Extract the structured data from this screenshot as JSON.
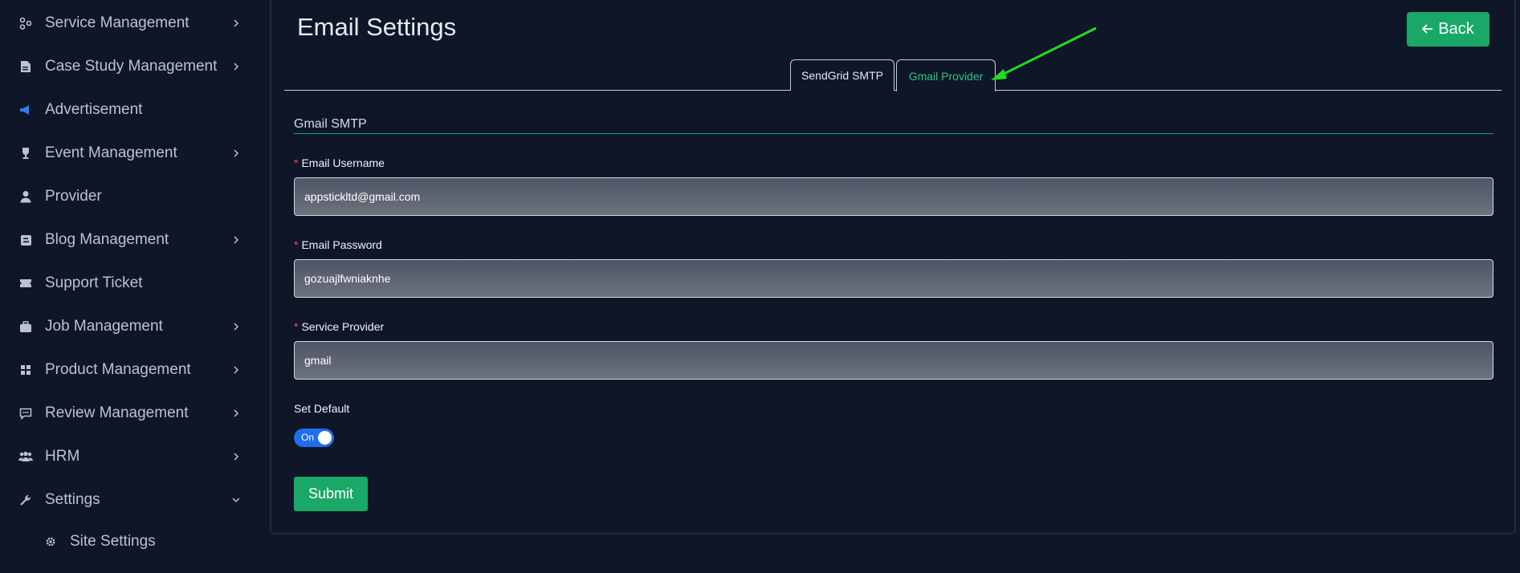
{
  "sidebar": {
    "items": [
      {
        "label": "Service Management",
        "icon": "service-icon",
        "has_chevron": true
      },
      {
        "label": "Case Study Management",
        "icon": "document-icon",
        "has_chevron": true
      },
      {
        "label": "Advertisement",
        "icon": "megaphone-icon",
        "has_chevron": false
      },
      {
        "label": "Event Management",
        "icon": "trophy-icon",
        "has_chevron": true
      },
      {
        "label": "Provider",
        "icon": "user-icon",
        "has_chevron": false
      },
      {
        "label": "Blog Management",
        "icon": "blog-icon",
        "has_chevron": true
      },
      {
        "label": "Support Ticket",
        "icon": "ticket-icon",
        "has_chevron": false
      },
      {
        "label": "Job Management",
        "icon": "briefcase-icon",
        "has_chevron": true
      },
      {
        "label": "Product Management",
        "icon": "grid-icon",
        "has_chevron": true
      },
      {
        "label": "Review Management",
        "icon": "review-icon",
        "has_chevron": true
      },
      {
        "label": "HRM",
        "icon": "people-icon",
        "has_chevron": true
      },
      {
        "label": "Settings",
        "icon": "wrench-icon",
        "has_chevron": true,
        "expanded": true
      }
    ],
    "sub_items": [
      {
        "label": "Site Settings",
        "icon": "gear-icon"
      }
    ]
  },
  "header": {
    "title": "Email Settings",
    "back_label": "Back"
  },
  "tabs": [
    {
      "label": "SendGrid SMTP",
      "active": false
    },
    {
      "label": "Gmail Provider",
      "active": true
    }
  ],
  "form": {
    "section_title": "Gmail SMTP",
    "username_label": "Email Username",
    "username_value": "appstickltd@gmail.com",
    "password_label": "Email Password",
    "password_value": "gozuajlfwniaknhe",
    "provider_label": "Service Provider",
    "provider_value": "gmail",
    "default_label": "Set Default",
    "toggle_text": "On",
    "submit_label": "Submit"
  },
  "colors": {
    "background": "#0e1628",
    "accent": "#1aa868",
    "active_tab": "#2bc48a",
    "toggle": "#1f6feb",
    "required": "#e0564f",
    "annotation_arrow": "#22dd22"
  }
}
